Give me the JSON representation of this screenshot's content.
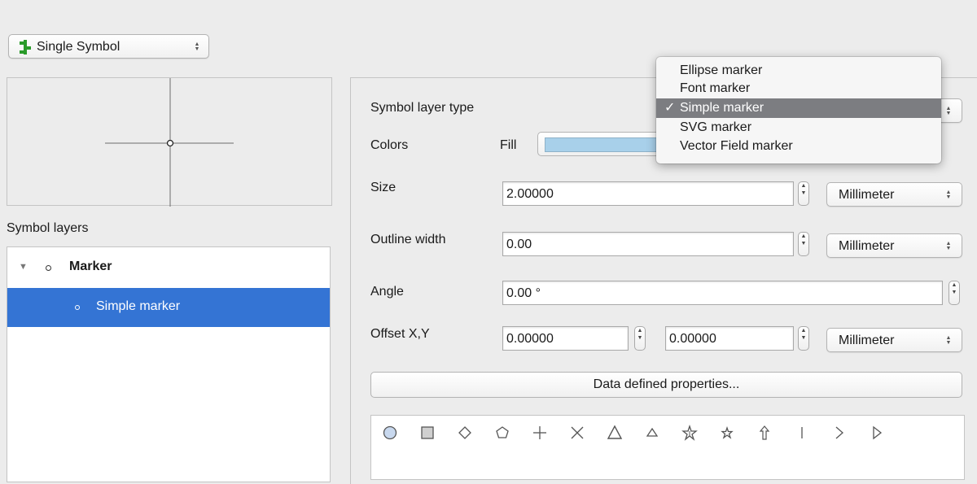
{
  "renderer": {
    "label": "Single Symbol",
    "icon": "single-symbol-icon"
  },
  "symbol_layers": {
    "heading": "Symbol layers",
    "items": [
      {
        "label": "Marker",
        "expanded": true,
        "selected": false
      },
      {
        "label": "Simple marker",
        "selected": true
      }
    ]
  },
  "properties": {
    "symbol_layer_type_label": "Symbol layer type",
    "colors_label": "Colors",
    "fill_label": "Fill",
    "fill_color": "#a8d0ea",
    "size_label": "Size",
    "size_value": "2.00000",
    "size_unit": "Millimeter",
    "outline_width_label": "Outline width",
    "outline_width_value": "0.00",
    "outline_unit": "Millimeter",
    "angle_label": "Angle",
    "angle_value": "0.00 °",
    "offset_label": "Offset X,Y",
    "offset_x": "0.00000",
    "offset_y": "0.00000",
    "offset_unit": "Millimeter",
    "data_defined_button": "Data defined properties..."
  },
  "layer_type_menu": {
    "items": [
      "Ellipse marker",
      "Font marker",
      "Simple marker",
      "SVG marker",
      "Vector Field marker"
    ],
    "selected": "Simple marker",
    "check_glyph": "✓"
  },
  "shapes": [
    "circle-icon",
    "square-icon",
    "diamond-icon",
    "pentagon-icon",
    "cross-icon",
    "x-icon",
    "triangle-icon",
    "equilateral-triangle-icon",
    "star-icon",
    "regular-star-icon",
    "arrow-icon",
    "line-icon",
    "arrowhead-icon",
    "filled-arrowhead-icon"
  ]
}
